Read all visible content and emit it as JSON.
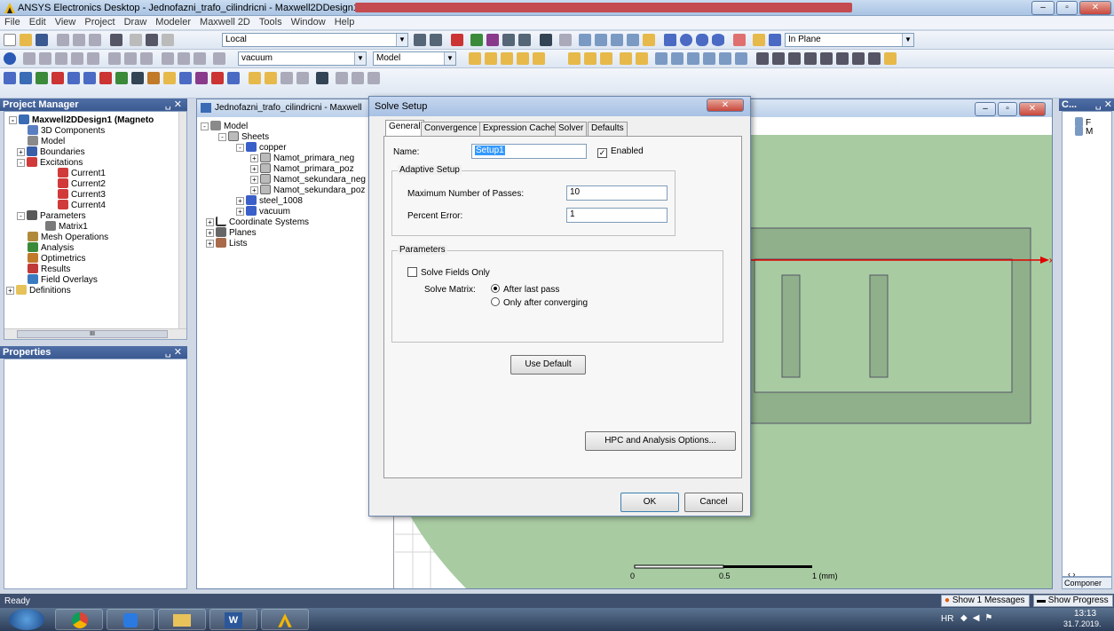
{
  "window": {
    "title": "ANSYS Electronics Desktop - Jednofazni_trafo_cilindricni - Maxwell2DDesign1 - 3D Modeler"
  },
  "menu": [
    "File",
    "Edit",
    "View",
    "Project",
    "Draw",
    "Modeler",
    "Maxwell 2D",
    "Tools",
    "Window",
    "Help"
  ],
  "toolbar": {
    "coord_combo": "Local",
    "material_combo": "vacuum",
    "model_combo": "Model",
    "plane_combo": "In Plane"
  },
  "project_manager": {
    "title": "Project Manager",
    "pin": "␣ ✕",
    "items": [
      {
        "label": "Maxwell2DDesign1 (Magneto",
        "icon": "design-icon",
        "color": "#3a6bb5"
      },
      {
        "label": "3D Components",
        "icon": "component-icon",
        "color": "#5a7ec2"
      },
      {
        "label": "Model",
        "icon": "model-icon",
        "color": "#8a8a8a"
      },
      {
        "label": "Boundaries",
        "icon": "boundary-icon",
        "color": "#3a5fa8"
      },
      {
        "label": "Excitations",
        "icon": "excitation-icon",
        "color": "#d03a3a"
      },
      {
        "label": "Current1",
        "icon": "current-icon",
        "color": "#d03a3a"
      },
      {
        "label": "Current2",
        "icon": "current-icon",
        "color": "#d03a3a"
      },
      {
        "label": "Current3",
        "icon": "current-icon",
        "color": "#d03a3a"
      },
      {
        "label": "Current4",
        "icon": "current-icon",
        "color": "#d03a3a"
      },
      {
        "label": "Parameters",
        "icon": "parameter-icon",
        "color": "#5a5a5a"
      },
      {
        "label": "Matrix1",
        "icon": "matrix-icon",
        "color": "#7a7a7a"
      },
      {
        "label": "Mesh Operations",
        "icon": "mesh-icon",
        "color": "#b08a3a"
      },
      {
        "label": "Analysis",
        "icon": "analysis-icon",
        "color": "#3a8a3a"
      },
      {
        "label": "Optimetrics",
        "icon": "optimetrics-icon",
        "color": "#c07a2a"
      },
      {
        "label": "Results",
        "icon": "results-icon",
        "color": "#c03a3a"
      },
      {
        "label": "Field Overlays",
        "icon": "overlay-icon",
        "color": "#3a7ac0"
      },
      {
        "label": "Definitions",
        "icon": "folder-icon",
        "color": "#e6c25a"
      }
    ],
    "scroll_dots": "III"
  },
  "properties": {
    "title": "Properties",
    "pin": "␣ ✕"
  },
  "modeler": {
    "tab_title": "Jednofazni_trafo_cilindricni - Maxwell",
    "tree": [
      {
        "label": "Model",
        "icon": "model-icon"
      },
      {
        "label": "Sheets",
        "icon": "sheet-icon"
      },
      {
        "label": "copper",
        "icon": "material-icon"
      },
      {
        "label": "Namot_primara_neg",
        "icon": "sheet-icon"
      },
      {
        "label": "Namot_primara_poz",
        "icon": "sheet-icon"
      },
      {
        "label": "Namot_sekundara_neg",
        "icon": "sheet-icon"
      },
      {
        "label": "Namot_sekundara_poz",
        "icon": "sheet-icon"
      },
      {
        "label": "steel_1008",
        "icon": "material-icon"
      },
      {
        "label": "vacuum",
        "icon": "material-icon"
      },
      {
        "label": "Coordinate Systems",
        "icon": "axes-icon"
      },
      {
        "label": "Planes",
        "icon": "plane-icon"
      },
      {
        "label": "Lists",
        "icon": "list-icon"
      }
    ],
    "axis_label": "x",
    "scale": {
      "t0": "0",
      "t1": "0.5",
      "t2": "1 (mm)"
    }
  },
  "dialog": {
    "title": "Solve Setup",
    "tabs": [
      "General",
      "Convergence",
      "Expression Cache",
      "Solver",
      "Defaults"
    ],
    "name_label": "Name:",
    "name_value": "Setup1",
    "enabled_label": "Enabled",
    "adaptive_group": "Adaptive Setup",
    "max_passes_label": "Maximum Number of Passes:",
    "max_passes_value": "10",
    "percent_error_label": "Percent Error:",
    "percent_error_value": "1",
    "params_group": "Parameters",
    "solve_fields_label": "Solve Fields Only",
    "solve_matrix_label": "Solve Matrix:",
    "after_last_pass": "After last pass",
    "only_after_converging": "Only after converging",
    "use_default": "Use Default",
    "hpc": "HPC and Analysis Options...",
    "ok": "OK",
    "cancel": "Cancel"
  },
  "right_panel": {
    "title": "C...",
    "pin": "␣ ✕",
    "item1": "F",
    "item2": "M",
    "bottom_tab": "Componer"
  },
  "status": {
    "text": "Ready",
    "messages": "Show 1 Messages",
    "progress": "Show Progress"
  },
  "tray": {
    "lang": "HR",
    "time": "13:13",
    "date": "31.7.2019."
  }
}
